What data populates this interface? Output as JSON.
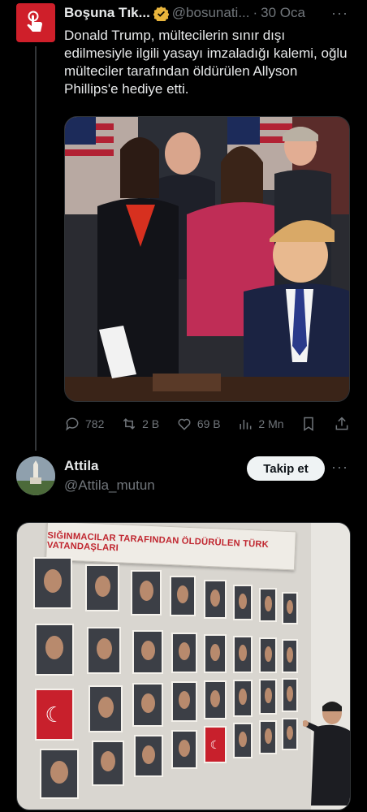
{
  "tweet": {
    "display_name": "Boşuna Tık...",
    "handle": "@bosunati...",
    "separator": "·",
    "date": "30 Oca",
    "more": "···",
    "text": "Donald Trump, mültecilerin sınır dışı edilmesiyle ilgili yasayı imzaladığı kalemi, oğlu mülteciler tarafından öldürülen Allyson Phillips'e hediye etti.",
    "stats": {
      "replies": "782",
      "reposts": "2 B",
      "likes": "69 B",
      "views": "2 Mn"
    },
    "colors": {
      "avatar_bg": "#cf1f2a",
      "verified": "#e8b43c"
    }
  },
  "reply": {
    "display_name": "Attila",
    "handle": "@Attila_mutun",
    "follow_label": "Takip et",
    "more": "···",
    "image_banner": "SIĞINMACILAR TARAFINDAN ÖLDÜRÜLEN TÜRK VATANDAŞLARI"
  }
}
